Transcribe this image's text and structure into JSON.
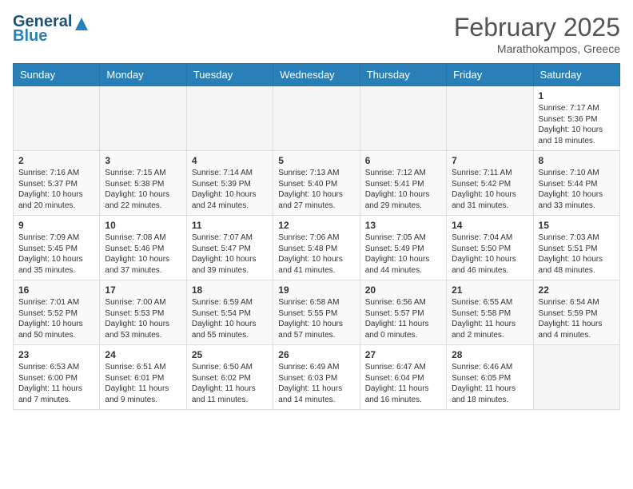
{
  "header": {
    "logo_line1": "General",
    "logo_line2": "Blue",
    "month_year": "February 2025",
    "location": "Marathokampos, Greece"
  },
  "weekdays": [
    "Sunday",
    "Monday",
    "Tuesday",
    "Wednesday",
    "Thursday",
    "Friday",
    "Saturday"
  ],
  "weeks": [
    [
      {
        "day": "",
        "info": ""
      },
      {
        "day": "",
        "info": ""
      },
      {
        "day": "",
        "info": ""
      },
      {
        "day": "",
        "info": ""
      },
      {
        "day": "",
        "info": ""
      },
      {
        "day": "",
        "info": ""
      },
      {
        "day": "1",
        "info": "Sunrise: 7:17 AM\nSunset: 5:36 PM\nDaylight: 10 hours and 18 minutes."
      }
    ],
    [
      {
        "day": "2",
        "info": "Sunrise: 7:16 AM\nSunset: 5:37 PM\nDaylight: 10 hours and 20 minutes."
      },
      {
        "day": "3",
        "info": "Sunrise: 7:15 AM\nSunset: 5:38 PM\nDaylight: 10 hours and 22 minutes."
      },
      {
        "day": "4",
        "info": "Sunrise: 7:14 AM\nSunset: 5:39 PM\nDaylight: 10 hours and 24 minutes."
      },
      {
        "day": "5",
        "info": "Sunrise: 7:13 AM\nSunset: 5:40 PM\nDaylight: 10 hours and 27 minutes."
      },
      {
        "day": "6",
        "info": "Sunrise: 7:12 AM\nSunset: 5:41 PM\nDaylight: 10 hours and 29 minutes."
      },
      {
        "day": "7",
        "info": "Sunrise: 7:11 AM\nSunset: 5:42 PM\nDaylight: 10 hours and 31 minutes."
      },
      {
        "day": "8",
        "info": "Sunrise: 7:10 AM\nSunset: 5:44 PM\nDaylight: 10 hours and 33 minutes."
      }
    ],
    [
      {
        "day": "9",
        "info": "Sunrise: 7:09 AM\nSunset: 5:45 PM\nDaylight: 10 hours and 35 minutes."
      },
      {
        "day": "10",
        "info": "Sunrise: 7:08 AM\nSunset: 5:46 PM\nDaylight: 10 hours and 37 minutes."
      },
      {
        "day": "11",
        "info": "Sunrise: 7:07 AM\nSunset: 5:47 PM\nDaylight: 10 hours and 39 minutes."
      },
      {
        "day": "12",
        "info": "Sunrise: 7:06 AM\nSunset: 5:48 PM\nDaylight: 10 hours and 41 minutes."
      },
      {
        "day": "13",
        "info": "Sunrise: 7:05 AM\nSunset: 5:49 PM\nDaylight: 10 hours and 44 minutes."
      },
      {
        "day": "14",
        "info": "Sunrise: 7:04 AM\nSunset: 5:50 PM\nDaylight: 10 hours and 46 minutes."
      },
      {
        "day": "15",
        "info": "Sunrise: 7:03 AM\nSunset: 5:51 PM\nDaylight: 10 hours and 48 minutes."
      }
    ],
    [
      {
        "day": "16",
        "info": "Sunrise: 7:01 AM\nSunset: 5:52 PM\nDaylight: 10 hours and 50 minutes."
      },
      {
        "day": "17",
        "info": "Sunrise: 7:00 AM\nSunset: 5:53 PM\nDaylight: 10 hours and 53 minutes."
      },
      {
        "day": "18",
        "info": "Sunrise: 6:59 AM\nSunset: 5:54 PM\nDaylight: 10 hours and 55 minutes."
      },
      {
        "day": "19",
        "info": "Sunrise: 6:58 AM\nSunset: 5:55 PM\nDaylight: 10 hours and 57 minutes."
      },
      {
        "day": "20",
        "info": "Sunrise: 6:56 AM\nSunset: 5:57 PM\nDaylight: 11 hours and 0 minutes."
      },
      {
        "day": "21",
        "info": "Sunrise: 6:55 AM\nSunset: 5:58 PM\nDaylight: 11 hours and 2 minutes."
      },
      {
        "day": "22",
        "info": "Sunrise: 6:54 AM\nSunset: 5:59 PM\nDaylight: 11 hours and 4 minutes."
      }
    ],
    [
      {
        "day": "23",
        "info": "Sunrise: 6:53 AM\nSunset: 6:00 PM\nDaylight: 11 hours and 7 minutes."
      },
      {
        "day": "24",
        "info": "Sunrise: 6:51 AM\nSunset: 6:01 PM\nDaylight: 11 hours and 9 minutes."
      },
      {
        "day": "25",
        "info": "Sunrise: 6:50 AM\nSunset: 6:02 PM\nDaylight: 11 hours and 11 minutes."
      },
      {
        "day": "26",
        "info": "Sunrise: 6:49 AM\nSunset: 6:03 PM\nDaylight: 11 hours and 14 minutes."
      },
      {
        "day": "27",
        "info": "Sunrise: 6:47 AM\nSunset: 6:04 PM\nDaylight: 11 hours and 16 minutes."
      },
      {
        "day": "28",
        "info": "Sunrise: 6:46 AM\nSunset: 6:05 PM\nDaylight: 11 hours and 18 minutes."
      },
      {
        "day": "",
        "info": ""
      }
    ]
  ]
}
